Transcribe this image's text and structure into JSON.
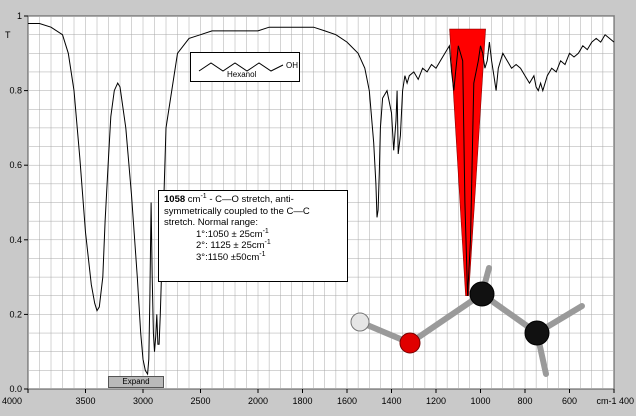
{
  "y_axis_title": "T",
  "molecule": {
    "name": "Hexanol",
    "group": "OH"
  },
  "annotation": {
    "wavenumber": "1058",
    "unit": "cm",
    "superscript": "-1",
    "line1_rest": " - C—O stretch, anti-",
    "line2": "symmetrically coupled to the C—C",
    "line3": "stretch. Normal range:",
    "r1_label": "1°:1050 ± 25cm",
    "r2_label": "2°: 1125 ± 25cm",
    "r3_label": "3°:1150 ±50cm"
  },
  "expand_button": "Expand",
  "colors": {
    "highlight": "#ff0000",
    "background": "#c9c9c9",
    "grid": "#a8a8a8"
  },
  "chart_data": {
    "type": "line",
    "title": "",
    "xlabel": "cm-1",
    "ylabel": "T",
    "xlim": [
      4000,
      400
    ],
    "ylim": [
      0.0,
      1.0
    ],
    "x_ticks": [
      4000,
      3500,
      3000,
      2500,
      2000,
      1800,
      1600,
      1400,
      1200,
      1000,
      800,
      600,
      400
    ],
    "x_tick_labels": [
      "4000",
      "3500",
      "3000",
      "2500",
      "2000",
      "1800",
      "1600",
      "1400",
      "1200",
      "1000",
      "800",
      "600",
      "cm-1 400"
    ],
    "y_ticks": [
      0.0,
      0.2,
      0.4,
      0.6,
      0.8,
      1.0
    ],
    "y_tick_labels": [
      "0.0",
      "0.2",
      "0.4",
      "0.6",
      "0.8",
      "1"
    ],
    "highlight_band": {
      "center": 1058,
      "label": "C-O stretch"
    },
    "series": [
      {
        "x": [
          4000,
          3900,
          3800,
          3700,
          3650,
          3600,
          3550,
          3500,
          3450,
          3420,
          3400,
          3380,
          3350,
          3330,
          3300,
          3280,
          3250,
          3220,
          3200,
          3150,
          3100,
          3050,
          3020,
          3000,
          2980,
          2960,
          2950,
          2940,
          2930,
          2920,
          2910,
          2900,
          2890,
          2880,
          2870,
          2860,
          2850,
          2800,
          2700,
          2600,
          2500,
          2400,
          2300,
          2200,
          2100,
          2000,
          1950,
          1900,
          1850,
          1800,
          1750,
          1700,
          1650,
          1600,
          1550,
          1520,
          1500,
          1480,
          1470,
          1465,
          1460,
          1455,
          1450,
          1440,
          1420,
          1400,
          1390,
          1380,
          1375,
          1370,
          1360,
          1350,
          1340,
          1330,
          1320,
          1300,
          1280,
          1260,
          1240,
          1220,
          1200,
          1180,
          1160,
          1140,
          1130,
          1120,
          1110,
          1100,
          1080,
          1070,
          1058,
          1045,
          1030,
          1010,
          1000,
          990,
          980,
          970,
          960,
          950,
          940,
          930,
          920,
          900,
          880,
          860,
          840,
          820,
          800,
          780,
          760,
          750,
          740,
          730,
          720,
          700,
          680,
          660,
          640,
          620,
          600,
          580,
          560,
          540,
          520,
          500,
          480,
          460,
          440,
          420,
          400
        ],
        "y": [
          0.98,
          0.98,
          0.97,
          0.95,
          0.9,
          0.8,
          0.62,
          0.42,
          0.28,
          0.23,
          0.21,
          0.22,
          0.3,
          0.45,
          0.62,
          0.73,
          0.8,
          0.82,
          0.81,
          0.7,
          0.52,
          0.3,
          0.15,
          0.08,
          0.05,
          0.04,
          0.08,
          0.25,
          0.5,
          0.3,
          0.15,
          0.1,
          0.14,
          0.2,
          0.12,
          0.12,
          0.2,
          0.7,
          0.9,
          0.94,
          0.95,
          0.96,
          0.96,
          0.96,
          0.96,
          0.96,
          0.97,
          0.97,
          0.97,
          0.97,
          0.97,
          0.96,
          0.95,
          0.93,
          0.9,
          0.86,
          0.8,
          0.66,
          0.55,
          0.46,
          0.48,
          0.58,
          0.7,
          0.78,
          0.8,
          0.74,
          0.64,
          0.72,
          0.8,
          0.63,
          0.68,
          0.8,
          0.84,
          0.82,
          0.84,
          0.85,
          0.83,
          0.86,
          0.85,
          0.87,
          0.86,
          0.88,
          0.9,
          0.92,
          0.85,
          0.8,
          0.86,
          0.92,
          0.88,
          0.5,
          0.25,
          0.4,
          0.82,
          0.88,
          0.92,
          0.9,
          0.86,
          0.88,
          0.93,
          0.88,
          0.84,
          0.8,
          0.86,
          0.9,
          0.88,
          0.86,
          0.87,
          0.86,
          0.84,
          0.82,
          0.84,
          0.81,
          0.8,
          0.82,
          0.8,
          0.84,
          0.86,
          0.85,
          0.88,
          0.87,
          0.9,
          0.89,
          0.9,
          0.92,
          0.91,
          0.93,
          0.94,
          0.93,
          0.95,
          0.94,
          0.93
        ]
      }
    ]
  }
}
